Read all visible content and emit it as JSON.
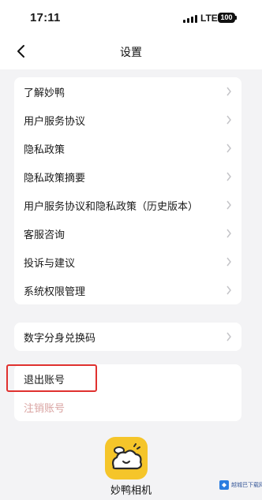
{
  "status_bar": {
    "time": "17:11",
    "network": "LTE",
    "battery": "100"
  },
  "nav": {
    "title": "设置",
    "back_icon": "chevron-left-icon"
  },
  "settings_group_1": [
    {
      "label": "了解妙鸭"
    },
    {
      "label": "用户服务协议"
    },
    {
      "label": "隐私政策"
    },
    {
      "label": "隐私政策摘要"
    },
    {
      "label": "用户服务协议和隐私政策（历史版本）"
    },
    {
      "label": "客服咨询"
    },
    {
      "label": "投诉与建议"
    },
    {
      "label": "系统权限管理"
    }
  ],
  "settings_group_2": [
    {
      "label": "数字分身兑换码"
    }
  ],
  "account_group": {
    "logout_label": "退出账号",
    "cancel_account_label": "注销账号"
  },
  "app_info": {
    "name": "妙鸭相机",
    "logo_icon": "duck-cloud-logo-icon",
    "logo_color": "#f5c52a"
  },
  "watermark": {
    "text": "越城巴下载网"
  },
  "colors": {
    "highlight": "#e0312f",
    "cancel_text": "#d9a3a1",
    "page_bg": "#f3f3f5"
  }
}
